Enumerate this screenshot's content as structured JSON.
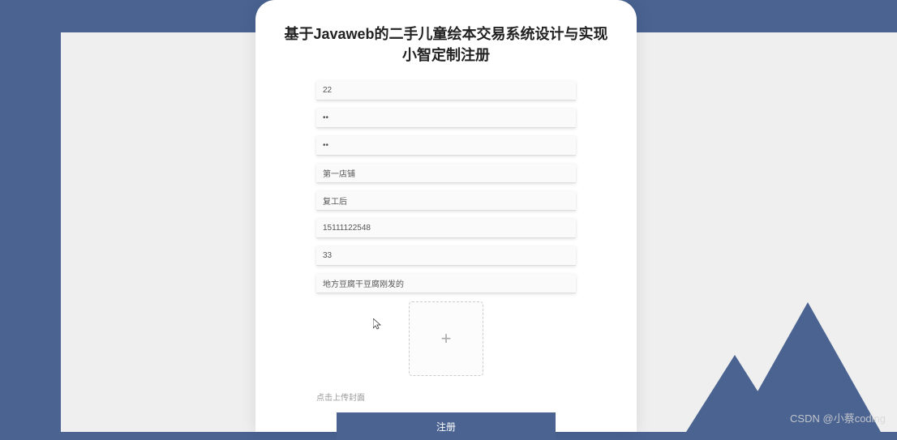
{
  "page": {
    "title": "基于Javaweb的二手儿童绘本交易系统设计与实现 小智定制注册"
  },
  "fields": {
    "f0": "22",
    "f1": "••",
    "f2": "••",
    "f3": "第一店铺",
    "f4": "复工后",
    "f5": "15111122548",
    "f6": "33",
    "f7": "地方豆腐干豆腐刚发的"
  },
  "upload": {
    "hint": "点击上传封面",
    "plus": "+"
  },
  "buttons": {
    "submit": "注册"
  },
  "watermark": "CSDN @小蔡coding"
}
